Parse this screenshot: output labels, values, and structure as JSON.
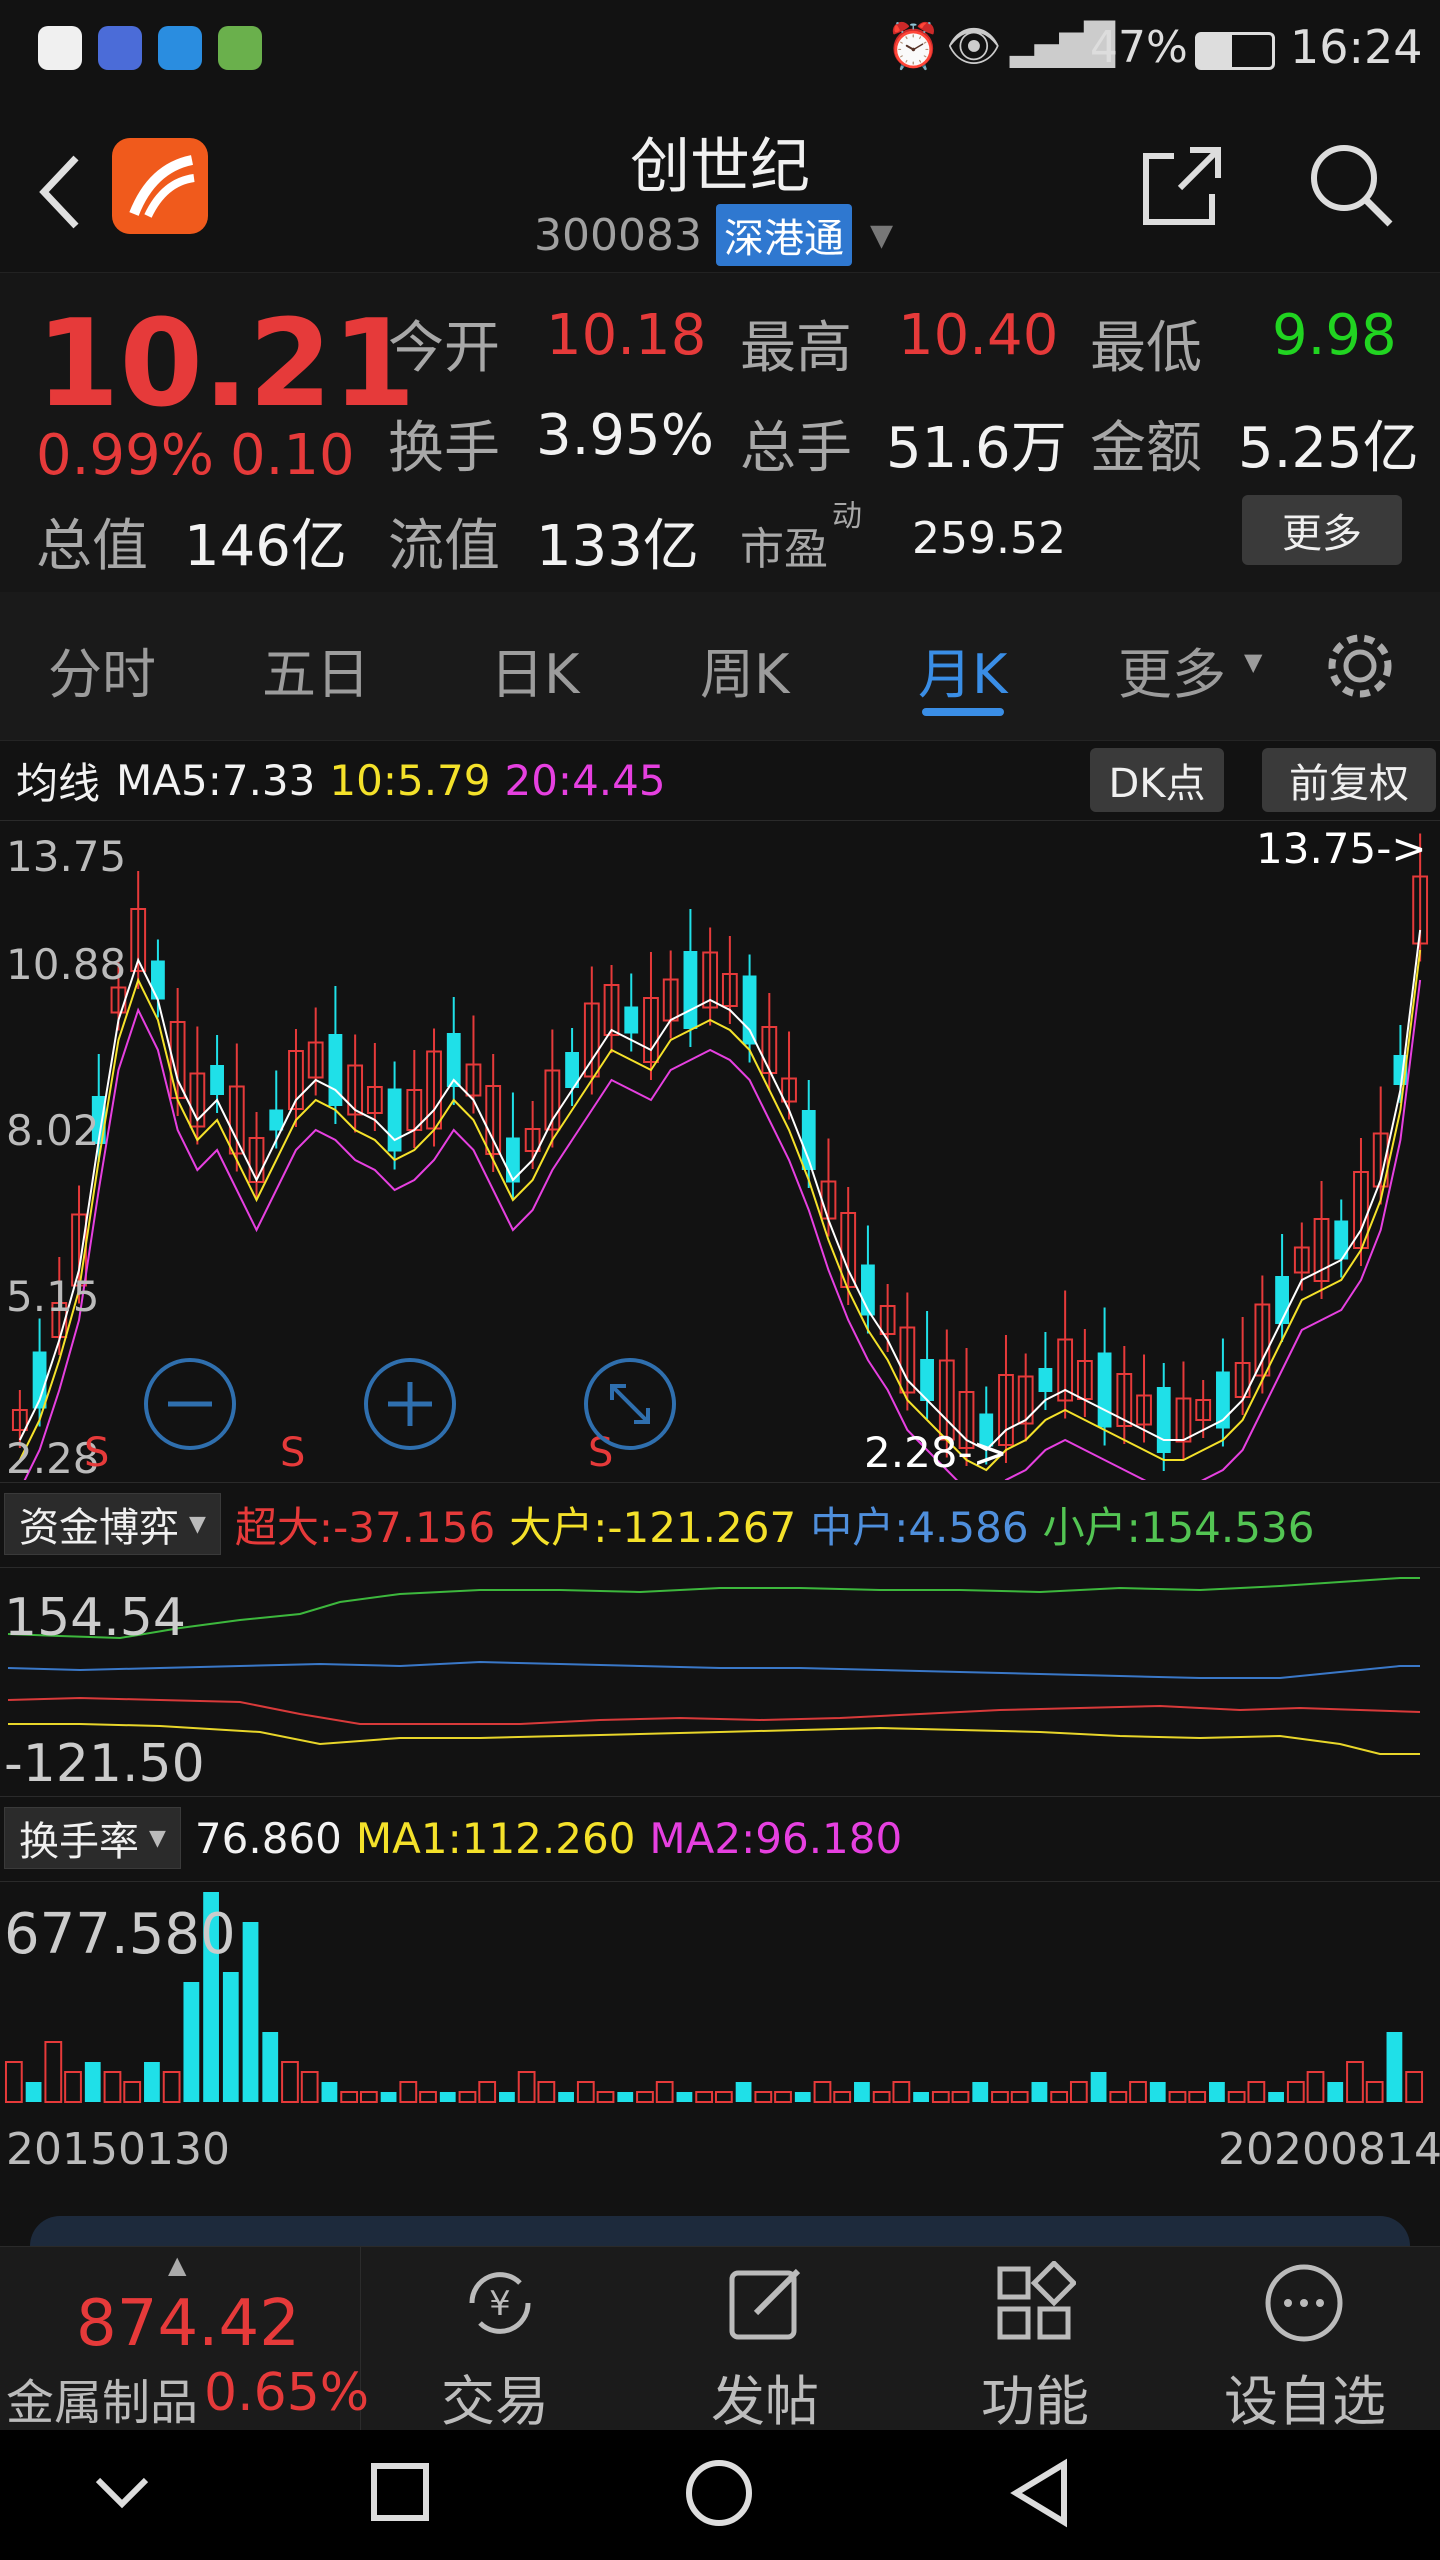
{
  "status_bar": {
    "battery": "47%",
    "time": "16:24"
  },
  "header": {
    "title": "创世纪",
    "code": "300083",
    "badge": "深港通"
  },
  "quote": {
    "price": "10.21",
    "change_pct": "0.99%",
    "change": "0.10",
    "open_label": "今开",
    "open": "10.18",
    "high_label": "最高",
    "high": "10.40",
    "low_label": "最低",
    "low": "9.98",
    "turnover_label": "换手",
    "turnover": "3.95%",
    "volume_label": "总手",
    "volume": "51.6万",
    "amount_label": "金额",
    "amount": "5.25亿",
    "total_cap_label": "总值",
    "total_cap": "146亿",
    "float_cap_label": "流值",
    "float_cap": "133亿",
    "pe_label": "市盈",
    "pe_sup": "动",
    "pe": "259.52",
    "more_button": "更多"
  },
  "tabs": [
    {
      "label": "分时"
    },
    {
      "label": "五日"
    },
    {
      "label": "日K"
    },
    {
      "label": "周K"
    },
    {
      "label": "月K"
    },
    {
      "label": "更多"
    }
  ],
  "ma_row": {
    "label": "均线",
    "ma5": "MA5:7.33",
    "ma10": "10:5.79",
    "ma20": "20:4.45",
    "dk_button": "DK点",
    "adjust_button": "前复权"
  },
  "kchart": {
    "axis_labels": [
      "13.75",
      "10.88",
      "8.02",
      "5.15",
      "2.28"
    ],
    "max_marker": "13.75->",
    "min_marker": "2.28->",
    "signal": "S"
  },
  "fund_row": {
    "select": "资金博弈",
    "super_large": "超大:-37.156",
    "large": "大户:-121.267",
    "medium": "中户:4.586",
    "small": "小户:154.536",
    "axis_top": "154.54",
    "axis_bottom": "-121.50"
  },
  "turn_row": {
    "select": "换手率",
    "value": "76.860",
    "ma1": "MA1:112.260",
    "ma2": "MA2:96.180",
    "axis_top": "677.580"
  },
  "dates": {
    "start": "20150130",
    "end": "20200814"
  },
  "bottom": {
    "index_value": "874.42",
    "index_name": "金属制品",
    "index_change": "0.65%",
    "trade": "交易",
    "post": "发帖",
    "function": "功能",
    "watchlist": "设自选"
  },
  "colors": {
    "up": "#e63a3a",
    "down": "#1fe0e8",
    "accent": "#3a8ee6"
  }
}
